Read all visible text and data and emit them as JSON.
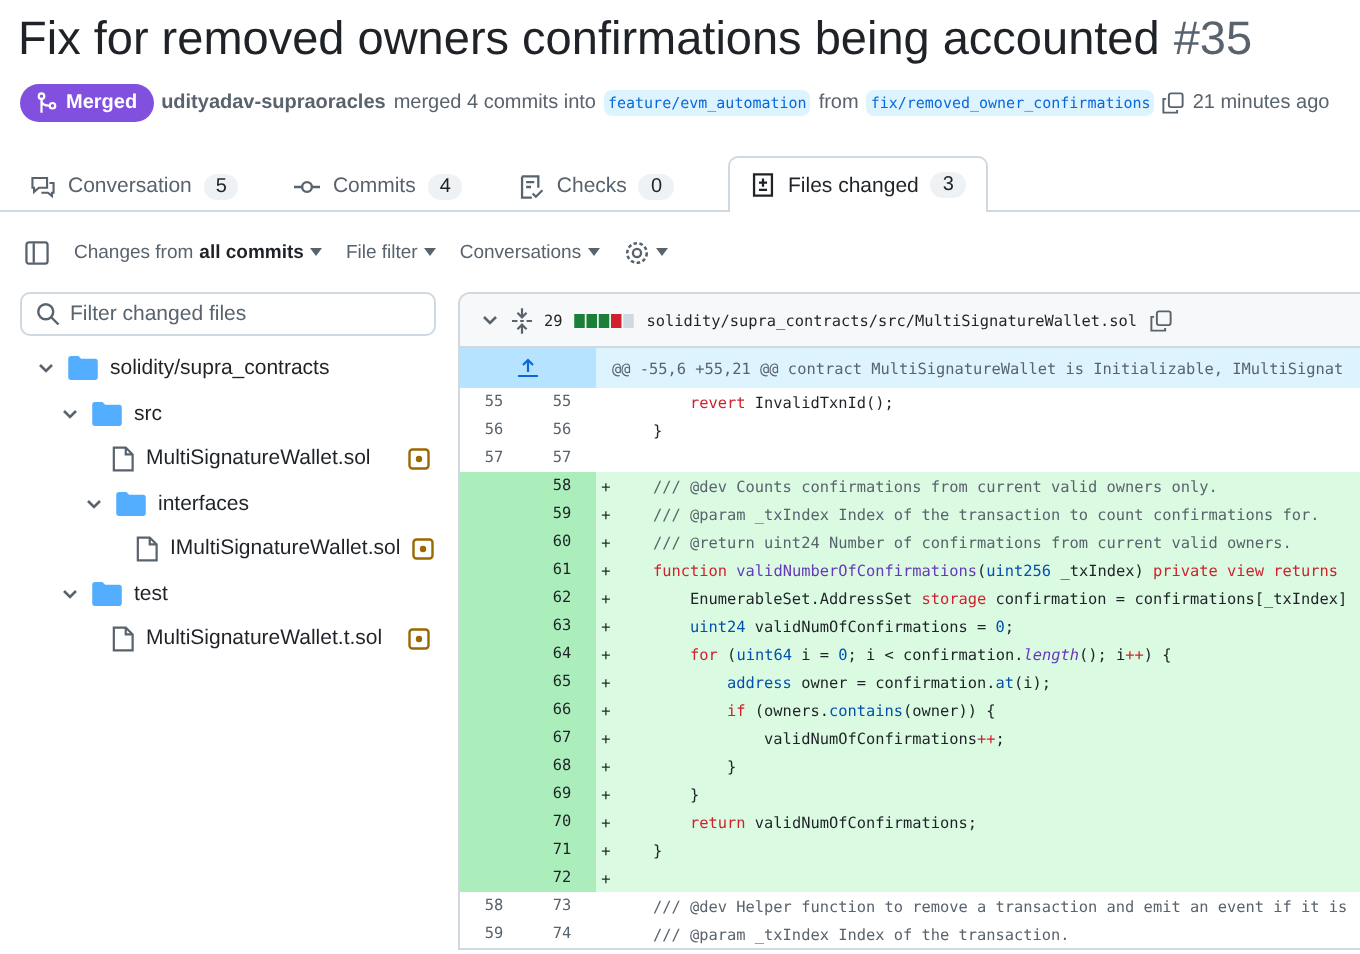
{
  "title": {
    "text": "Fix for removed owners confirmations being accounted",
    "number": "#35"
  },
  "state_badge": {
    "label": "Merged"
  },
  "meta": {
    "author": "udityadav-supraoracles",
    "action": "merged 4 commits into",
    "base": "feature/evm_automation",
    "from": "from",
    "head": "fix/removed_owner_confirmations",
    "time": "21 minutes ago"
  },
  "tabs": [
    {
      "label": "Conversation",
      "count": "5",
      "selected": false
    },
    {
      "label": "Commits",
      "count": "4",
      "selected": false
    },
    {
      "label": "Checks",
      "count": "0",
      "selected": false
    },
    {
      "label": "Files changed",
      "count": "3",
      "selected": true
    }
  ],
  "toolbar": {
    "changes_prefix": "Changes from",
    "changes_value": "all commits",
    "file_filter": "File filter",
    "conversations": "Conversations"
  },
  "filter": {
    "placeholder": "Filter changed files"
  },
  "tree": [
    {
      "kind": "folder",
      "name": "solidity/supra_contracts",
      "expanded": true,
      "children": [
        {
          "kind": "folder",
          "name": "src",
          "expanded": true,
          "children": [
            {
              "kind": "file",
              "name": "MultiSignatureWallet.sol"
            },
            {
              "kind": "folder",
              "name": "interfaces",
              "expanded": true,
              "children": [
                {
                  "kind": "file",
                  "name": "IMultiSignatureWallet.sol"
                }
              ]
            }
          ]
        },
        {
          "kind": "folder",
          "name": "test",
          "expanded": true,
          "children": [
            {
              "kind": "file",
              "name": "MultiSignatureWallet.t.sol"
            }
          ]
        }
      ]
    }
  ],
  "diff": {
    "changes": "29",
    "path": "solidity/supra_contracts/src/MultiSignatureWallet.sol",
    "expanded": true,
    "hunk": "@@ -55,6 +55,21 @@ contract MultiSignatureWallet is Initializable, IMultiSignat",
    "lines": [
      {
        "kind": "context",
        "old": "55",
        "new": "55",
        "tokens": [
          {
            "kind": "keyword",
            "s": "        revert"
          },
          {
            "kind": "plain",
            "s": " InvalidTxnId();"
          }
        ]
      },
      {
        "kind": "context",
        "old": "56",
        "new": "56",
        "tokens": [
          {
            "kind": "plain",
            "s": "    }"
          }
        ]
      },
      {
        "kind": "context",
        "old": "57",
        "new": "57"
      },
      {
        "kind": "add",
        "new": "58",
        "marker": "+",
        "tokens": [
          {
            "kind": "comment",
            "s": "    /// @dev Counts confirmations from current valid owners only."
          }
        ]
      },
      {
        "kind": "add",
        "new": "59",
        "marker": "+",
        "tokens": [
          {
            "kind": "comment",
            "s": "    /// @param _txIndex Index of the transaction to count confirmations for."
          }
        ]
      },
      {
        "kind": "add",
        "new": "60",
        "marker": "+",
        "tokens": [
          {
            "kind": "comment",
            "s": "    /// @return uint24 Number of confirmations from current valid owners."
          }
        ]
      },
      {
        "kind": "add",
        "new": "61",
        "marker": "+",
        "tokens": [
          {
            "kind": "keyword",
            "s": "    function"
          },
          {
            "kind": "function",
            "s": " validNumberOfConfirmations"
          },
          {
            "kind": "plain",
            "s": "("
          },
          {
            "kind": "type",
            "s": "uint256"
          },
          {
            "kind": "plain",
            "s": " _txIndex) "
          },
          {
            "kind": "keyword",
            "s": "private view returns"
          }
        ]
      },
      {
        "kind": "add",
        "new": "62",
        "marker": "+",
        "tokens": [
          {
            "kind": "plain",
            "s": "        EnumerableSet.AddressSet "
          },
          {
            "kind": "keyword",
            "s": "storage"
          },
          {
            "kind": "plain",
            "s": " confirmation = confirmations[_txIndex]"
          }
        ]
      },
      {
        "kind": "add",
        "new": "63",
        "marker": "+",
        "tokens": [
          {
            "kind": "type",
            "s": "        uint24"
          },
          {
            "kind": "plain",
            "s": " validNumOfConfirmations = "
          },
          {
            "kind": "type",
            "s": "0"
          },
          {
            "kind": "plain",
            "s": ";"
          }
        ]
      },
      {
        "kind": "add",
        "new": "64",
        "marker": "+",
        "tokens": [
          {
            "kind": "keyword",
            "s": "        for"
          },
          {
            "kind": "plain",
            "s": " ("
          },
          {
            "kind": "type",
            "s": "uint64"
          },
          {
            "kind": "plain",
            "s": " i = "
          },
          {
            "kind": "type",
            "s": "0"
          },
          {
            "kind": "plain",
            "s": "; i < confirmation."
          },
          {
            "kind": "italic",
            "s": "length"
          },
          {
            "kind": "plain",
            "s": "(); i"
          },
          {
            "kind": "keyword",
            "s": "++"
          },
          {
            "kind": "plain",
            "s": ") {"
          }
        ]
      },
      {
        "kind": "add",
        "new": "65",
        "marker": "+",
        "tokens": [
          {
            "kind": "type",
            "s": "            address"
          },
          {
            "kind": "plain",
            "s": " owner = confirmation."
          },
          {
            "kind": "type",
            "s": "at"
          },
          {
            "kind": "plain",
            "s": "(i);"
          }
        ]
      },
      {
        "kind": "add",
        "new": "66",
        "marker": "+",
        "tokens": [
          {
            "kind": "keyword",
            "s": "            if"
          },
          {
            "kind": "plain",
            "s": " (owners."
          },
          {
            "kind": "type",
            "s": "contains"
          },
          {
            "kind": "plain",
            "s": "(owner)) {"
          }
        ]
      },
      {
        "kind": "add",
        "new": "67",
        "marker": "+",
        "tokens": [
          {
            "kind": "plain",
            "s": "                validNumOfConfirmations"
          },
          {
            "kind": "keyword",
            "s": "++"
          },
          {
            "kind": "plain",
            "s": ";"
          }
        ]
      },
      {
        "kind": "add",
        "new": "68",
        "marker": "+",
        "tokens": [
          {
            "kind": "plain",
            "s": "            }"
          }
        ]
      },
      {
        "kind": "add",
        "new": "69",
        "marker": "+",
        "tokens": [
          {
            "kind": "plain",
            "s": "        }"
          }
        ]
      },
      {
        "kind": "add",
        "new": "70",
        "marker": "+",
        "tokens": [
          {
            "kind": "keyword",
            "s": "        return"
          },
          {
            "kind": "plain",
            "s": " validNumOfConfirmations;"
          }
        ]
      },
      {
        "kind": "add",
        "new": "71",
        "marker": "+",
        "tokens": [
          {
            "kind": "plain",
            "s": "    }"
          }
        ]
      },
      {
        "kind": "add",
        "new": "72",
        "marker": "+"
      },
      {
        "kind": "context",
        "old": "58",
        "new": "73",
        "tokens": [
          {
            "kind": "comment",
            "s": "    /// @dev Helper function to remove a transaction and emit an event if it is"
          }
        ]
      },
      {
        "kind": "context",
        "old": "59",
        "new": "74",
        "tokens": [
          {
            "kind": "comment",
            "s": "    /// @param _txIndex Index of the transaction."
          }
        ]
      }
    ]
  }
}
